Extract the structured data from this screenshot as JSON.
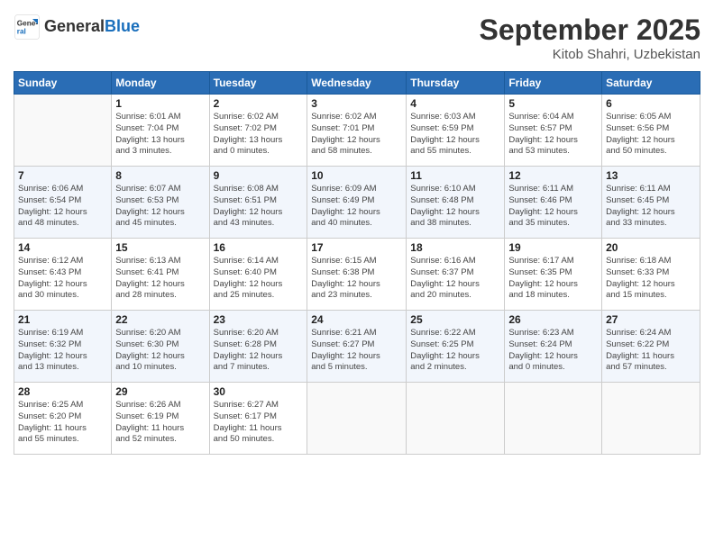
{
  "header": {
    "logo_line1": "General",
    "logo_line2": "Blue",
    "month": "September 2025",
    "location": "Kitob Shahri, Uzbekistan"
  },
  "days_of_week": [
    "Sunday",
    "Monday",
    "Tuesday",
    "Wednesday",
    "Thursday",
    "Friday",
    "Saturday"
  ],
  "weeks": [
    [
      {
        "day": "",
        "detail": ""
      },
      {
        "day": "1",
        "detail": "Sunrise: 6:01 AM\nSunset: 7:04 PM\nDaylight: 13 hours\nand 3 minutes."
      },
      {
        "day": "2",
        "detail": "Sunrise: 6:02 AM\nSunset: 7:02 PM\nDaylight: 13 hours\nand 0 minutes."
      },
      {
        "day": "3",
        "detail": "Sunrise: 6:02 AM\nSunset: 7:01 PM\nDaylight: 12 hours\nand 58 minutes."
      },
      {
        "day": "4",
        "detail": "Sunrise: 6:03 AM\nSunset: 6:59 PM\nDaylight: 12 hours\nand 55 minutes."
      },
      {
        "day": "5",
        "detail": "Sunrise: 6:04 AM\nSunset: 6:57 PM\nDaylight: 12 hours\nand 53 minutes."
      },
      {
        "day": "6",
        "detail": "Sunrise: 6:05 AM\nSunset: 6:56 PM\nDaylight: 12 hours\nand 50 minutes."
      }
    ],
    [
      {
        "day": "7",
        "detail": "Sunrise: 6:06 AM\nSunset: 6:54 PM\nDaylight: 12 hours\nand 48 minutes."
      },
      {
        "day": "8",
        "detail": "Sunrise: 6:07 AM\nSunset: 6:53 PM\nDaylight: 12 hours\nand 45 minutes."
      },
      {
        "day": "9",
        "detail": "Sunrise: 6:08 AM\nSunset: 6:51 PM\nDaylight: 12 hours\nand 43 minutes."
      },
      {
        "day": "10",
        "detail": "Sunrise: 6:09 AM\nSunset: 6:49 PM\nDaylight: 12 hours\nand 40 minutes."
      },
      {
        "day": "11",
        "detail": "Sunrise: 6:10 AM\nSunset: 6:48 PM\nDaylight: 12 hours\nand 38 minutes."
      },
      {
        "day": "12",
        "detail": "Sunrise: 6:11 AM\nSunset: 6:46 PM\nDaylight: 12 hours\nand 35 minutes."
      },
      {
        "day": "13",
        "detail": "Sunrise: 6:11 AM\nSunset: 6:45 PM\nDaylight: 12 hours\nand 33 minutes."
      }
    ],
    [
      {
        "day": "14",
        "detail": "Sunrise: 6:12 AM\nSunset: 6:43 PM\nDaylight: 12 hours\nand 30 minutes."
      },
      {
        "day": "15",
        "detail": "Sunrise: 6:13 AM\nSunset: 6:41 PM\nDaylight: 12 hours\nand 28 minutes."
      },
      {
        "day": "16",
        "detail": "Sunrise: 6:14 AM\nSunset: 6:40 PM\nDaylight: 12 hours\nand 25 minutes."
      },
      {
        "day": "17",
        "detail": "Sunrise: 6:15 AM\nSunset: 6:38 PM\nDaylight: 12 hours\nand 23 minutes."
      },
      {
        "day": "18",
        "detail": "Sunrise: 6:16 AM\nSunset: 6:37 PM\nDaylight: 12 hours\nand 20 minutes."
      },
      {
        "day": "19",
        "detail": "Sunrise: 6:17 AM\nSunset: 6:35 PM\nDaylight: 12 hours\nand 18 minutes."
      },
      {
        "day": "20",
        "detail": "Sunrise: 6:18 AM\nSunset: 6:33 PM\nDaylight: 12 hours\nand 15 minutes."
      }
    ],
    [
      {
        "day": "21",
        "detail": "Sunrise: 6:19 AM\nSunset: 6:32 PM\nDaylight: 12 hours\nand 13 minutes."
      },
      {
        "day": "22",
        "detail": "Sunrise: 6:20 AM\nSunset: 6:30 PM\nDaylight: 12 hours\nand 10 minutes."
      },
      {
        "day": "23",
        "detail": "Sunrise: 6:20 AM\nSunset: 6:28 PM\nDaylight: 12 hours\nand 7 minutes."
      },
      {
        "day": "24",
        "detail": "Sunrise: 6:21 AM\nSunset: 6:27 PM\nDaylight: 12 hours\nand 5 minutes."
      },
      {
        "day": "25",
        "detail": "Sunrise: 6:22 AM\nSunset: 6:25 PM\nDaylight: 12 hours\nand 2 minutes."
      },
      {
        "day": "26",
        "detail": "Sunrise: 6:23 AM\nSunset: 6:24 PM\nDaylight: 12 hours\nand 0 minutes."
      },
      {
        "day": "27",
        "detail": "Sunrise: 6:24 AM\nSunset: 6:22 PM\nDaylight: 11 hours\nand 57 minutes."
      }
    ],
    [
      {
        "day": "28",
        "detail": "Sunrise: 6:25 AM\nSunset: 6:20 PM\nDaylight: 11 hours\nand 55 minutes."
      },
      {
        "day": "29",
        "detail": "Sunrise: 6:26 AM\nSunset: 6:19 PM\nDaylight: 11 hours\nand 52 minutes."
      },
      {
        "day": "30",
        "detail": "Sunrise: 6:27 AM\nSunset: 6:17 PM\nDaylight: 11 hours\nand 50 minutes."
      },
      {
        "day": "",
        "detail": ""
      },
      {
        "day": "",
        "detail": ""
      },
      {
        "day": "",
        "detail": ""
      },
      {
        "day": "",
        "detail": ""
      }
    ]
  ]
}
